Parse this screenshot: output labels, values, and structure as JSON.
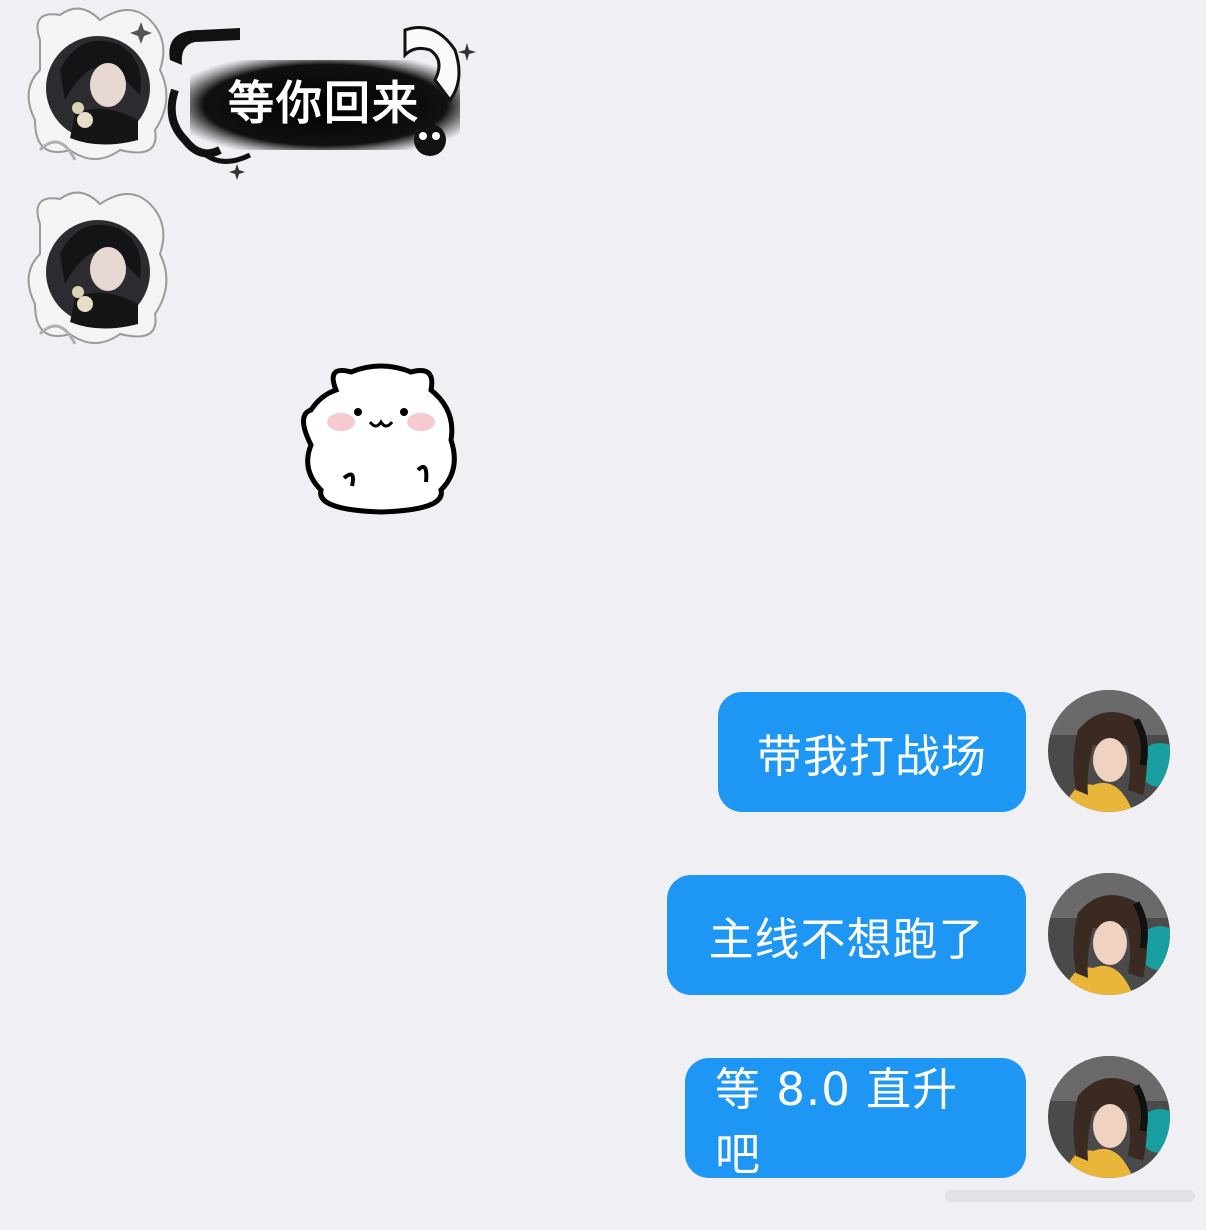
{
  "chat": {
    "incoming": {
      "sticker_caption": "等你回来",
      "sender_avatar_icon": "anime-avatar-icon",
      "bear_sticker_icon": "white-bear-sticker-icon"
    },
    "outgoing": [
      {
        "text": "带我打战场"
      },
      {
        "text": "主线不想跑了"
      },
      {
        "text": "等 8.0 直升吧"
      }
    ],
    "my_avatar_icon": "user-avatar-icon"
  },
  "colors": {
    "background": "#efeff4",
    "bubble": "#1e96f3",
    "bubble_text": "#ffffff"
  }
}
